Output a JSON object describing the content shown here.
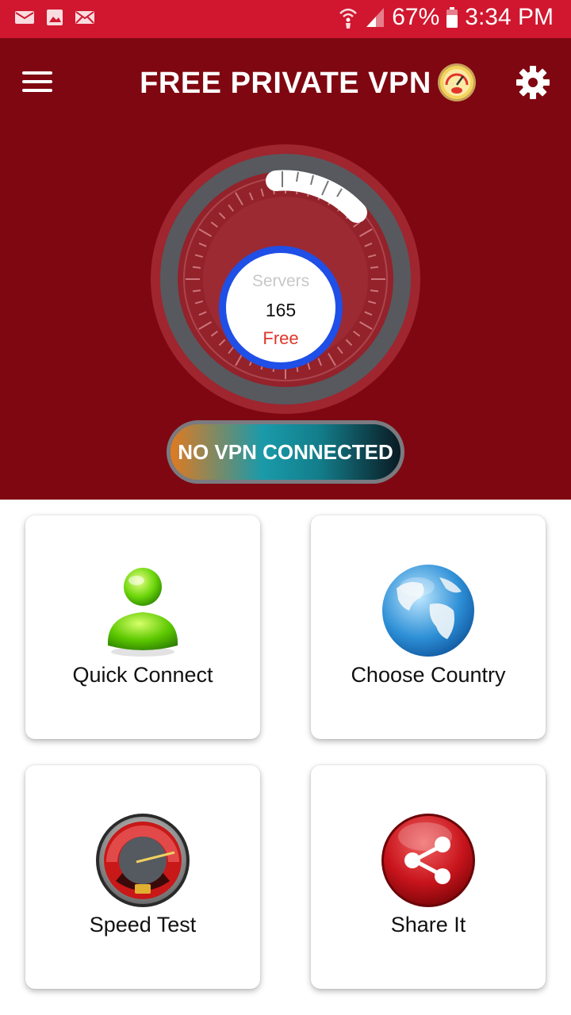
{
  "status_bar": {
    "battery_percent": "67%",
    "time": "3:34 PM",
    "icons_left": [
      "mail-icon",
      "image-icon",
      "email-icon"
    ],
    "icons_right": [
      "wifi-calling-icon",
      "signal-icon",
      "battery-icon"
    ]
  },
  "header": {
    "title": "FREE PRIVATE VPN",
    "menu_icon": "hamburger-menu-icon",
    "speed_icon": "speedometer-icon",
    "settings_icon": "gear-icon",
    "background_color": "#7f0711"
  },
  "dial": {
    "servers_label": "Servers",
    "server_count": "165",
    "free_label": "Free",
    "ring_color": "#1f4fe6"
  },
  "connection_status": {
    "label": "NO VPN CONNECTED"
  },
  "cards": [
    {
      "label": "Quick Connect",
      "icon": "user-icon"
    },
    {
      "label": "Choose Country",
      "icon": "globe-icon"
    },
    {
      "label": "Speed Test",
      "icon": "speedometer-icon"
    },
    {
      "label": "Share It",
      "icon": "share-icon"
    }
  ]
}
